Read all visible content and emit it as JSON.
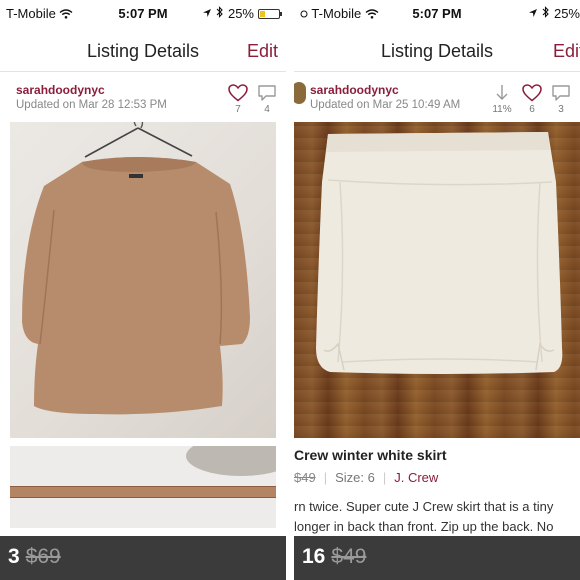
{
  "colors": {
    "brand": "#8a1e3a",
    "battery": "#f2c318",
    "pricebar": "#3b3b3b"
  },
  "left": {
    "status": {
      "carrier": "T-Mobile",
      "time": "5:07 PM",
      "battery": "25%",
      "battery_level": 0.25
    },
    "nav": {
      "title": "Listing Details",
      "edit": "Edit"
    },
    "user": {
      "name": "sarahdoodynyc",
      "updated": "Updated on Mar 28 12:53 PM"
    },
    "stats": {
      "likes": "7",
      "comments": "4"
    },
    "photo_icon": "sweater-on-hanger",
    "price": {
      "current": "3",
      "original": "$69"
    }
  },
  "right": {
    "status": {
      "carrier": "T-Mobile",
      "time": "5:07 PM",
      "battery": "25%",
      "battery_level": 0.25
    },
    "nav": {
      "title": "Listing Details",
      "edit": "Edit"
    },
    "user": {
      "name": "sarahdoodynyc",
      "updated": "Updated on Mar 25 10:49 AM"
    },
    "stats": {
      "drop": "11%",
      "likes": "6",
      "comments": "3"
    },
    "photo_icon": "white-skirt-on-floor",
    "item": {
      "title": "Crew winter white skirt",
      "orig_price": "$49",
      "size": "Size: 6",
      "brand": "J. Crew",
      "desc_line1": "rn twice. Super cute J Crew skirt that is a tiny",
      "desc_line2": "longer in back than front. Zip up the back. No"
    },
    "price": {
      "current": "16",
      "original": "$49"
    }
  }
}
